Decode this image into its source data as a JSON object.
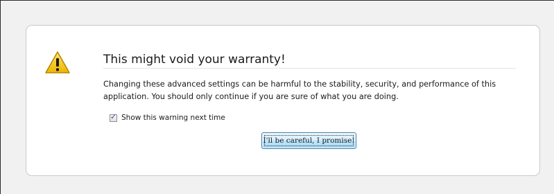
{
  "dialog": {
    "title": "This might void your warranty!",
    "message": "Changing these advanced settings can be harmful to the stability, security, and performance of this application. You should only continue if you are sure of what you are doing.",
    "icon": "warning-icon",
    "checkbox": {
      "label": "Show this warning next time",
      "checked": true
    },
    "confirm_button_label": "I'll be careful, I promise!"
  },
  "colors": {
    "page_background": "#f1f1f1",
    "panel_background": "#ffffff",
    "panel_border": "#c9c9c9",
    "warning_yellow": "#f3c300",
    "button_border": "#3c7fb1"
  }
}
